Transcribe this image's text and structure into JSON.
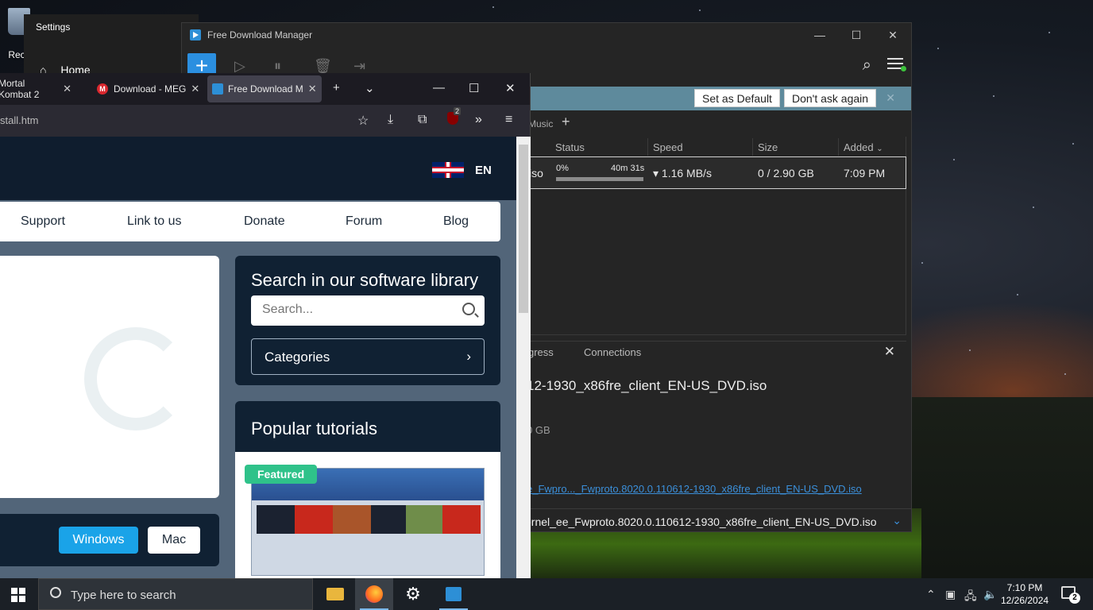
{
  "desktop": {
    "recycle_label": "Recy"
  },
  "settings_window": {
    "title": "Settings",
    "home": "Home"
  },
  "fdm": {
    "title": "Free Download Manager",
    "banner": {
      "set_default": "Set as Default",
      "dont_ask": "Don't ask again"
    },
    "tabs": {
      "music": "Music"
    },
    "columns": [
      "Status",
      "Speed",
      "Size",
      "Added"
    ],
    "row": {
      "name_tail": "iso",
      "percent": "0%",
      "eta": "40m 31s",
      "progress": 0,
      "speed": "▾ 1.16 MB/s",
      "size": "0 / 2.90 GB",
      "added": "7:09 PM"
    },
    "details": {
      "tab_progress": "gress",
      "tab_connections": "Connections",
      "filename": "12-1930_x86fre_client_EN-US_DVD.iso",
      "size": "0 GB",
      "link": "e_Fwpro..._Fwproto.8020.0.110612-1930_x86fre_client_EN-US_DVD.iso",
      "select": "ernel_ee_Fwproto.8020.0.110612-1930_x86fre_client_EN-US_DVD.iso"
    }
  },
  "browser": {
    "tabs": [
      "Mortal Kombat 2",
      "Download - MEG",
      "Free Download M"
    ],
    "url": "stall.htm",
    "ublock_count": "2"
  },
  "site": {
    "lang": "EN",
    "nav": [
      "Support",
      "Link to us",
      "Donate",
      "Forum",
      "Blog"
    ],
    "search_title": "Search in our software library",
    "search_placeholder": "Search...",
    "categories": "Categories",
    "tutorials_title": "Popular tutorials",
    "featured": "Featured",
    "windows": "Windows",
    "mac": "Mac"
  },
  "taskbar": {
    "search": "Type here to search",
    "time": "7:10 PM",
    "date": "12/26/2024",
    "notifications": "2"
  }
}
